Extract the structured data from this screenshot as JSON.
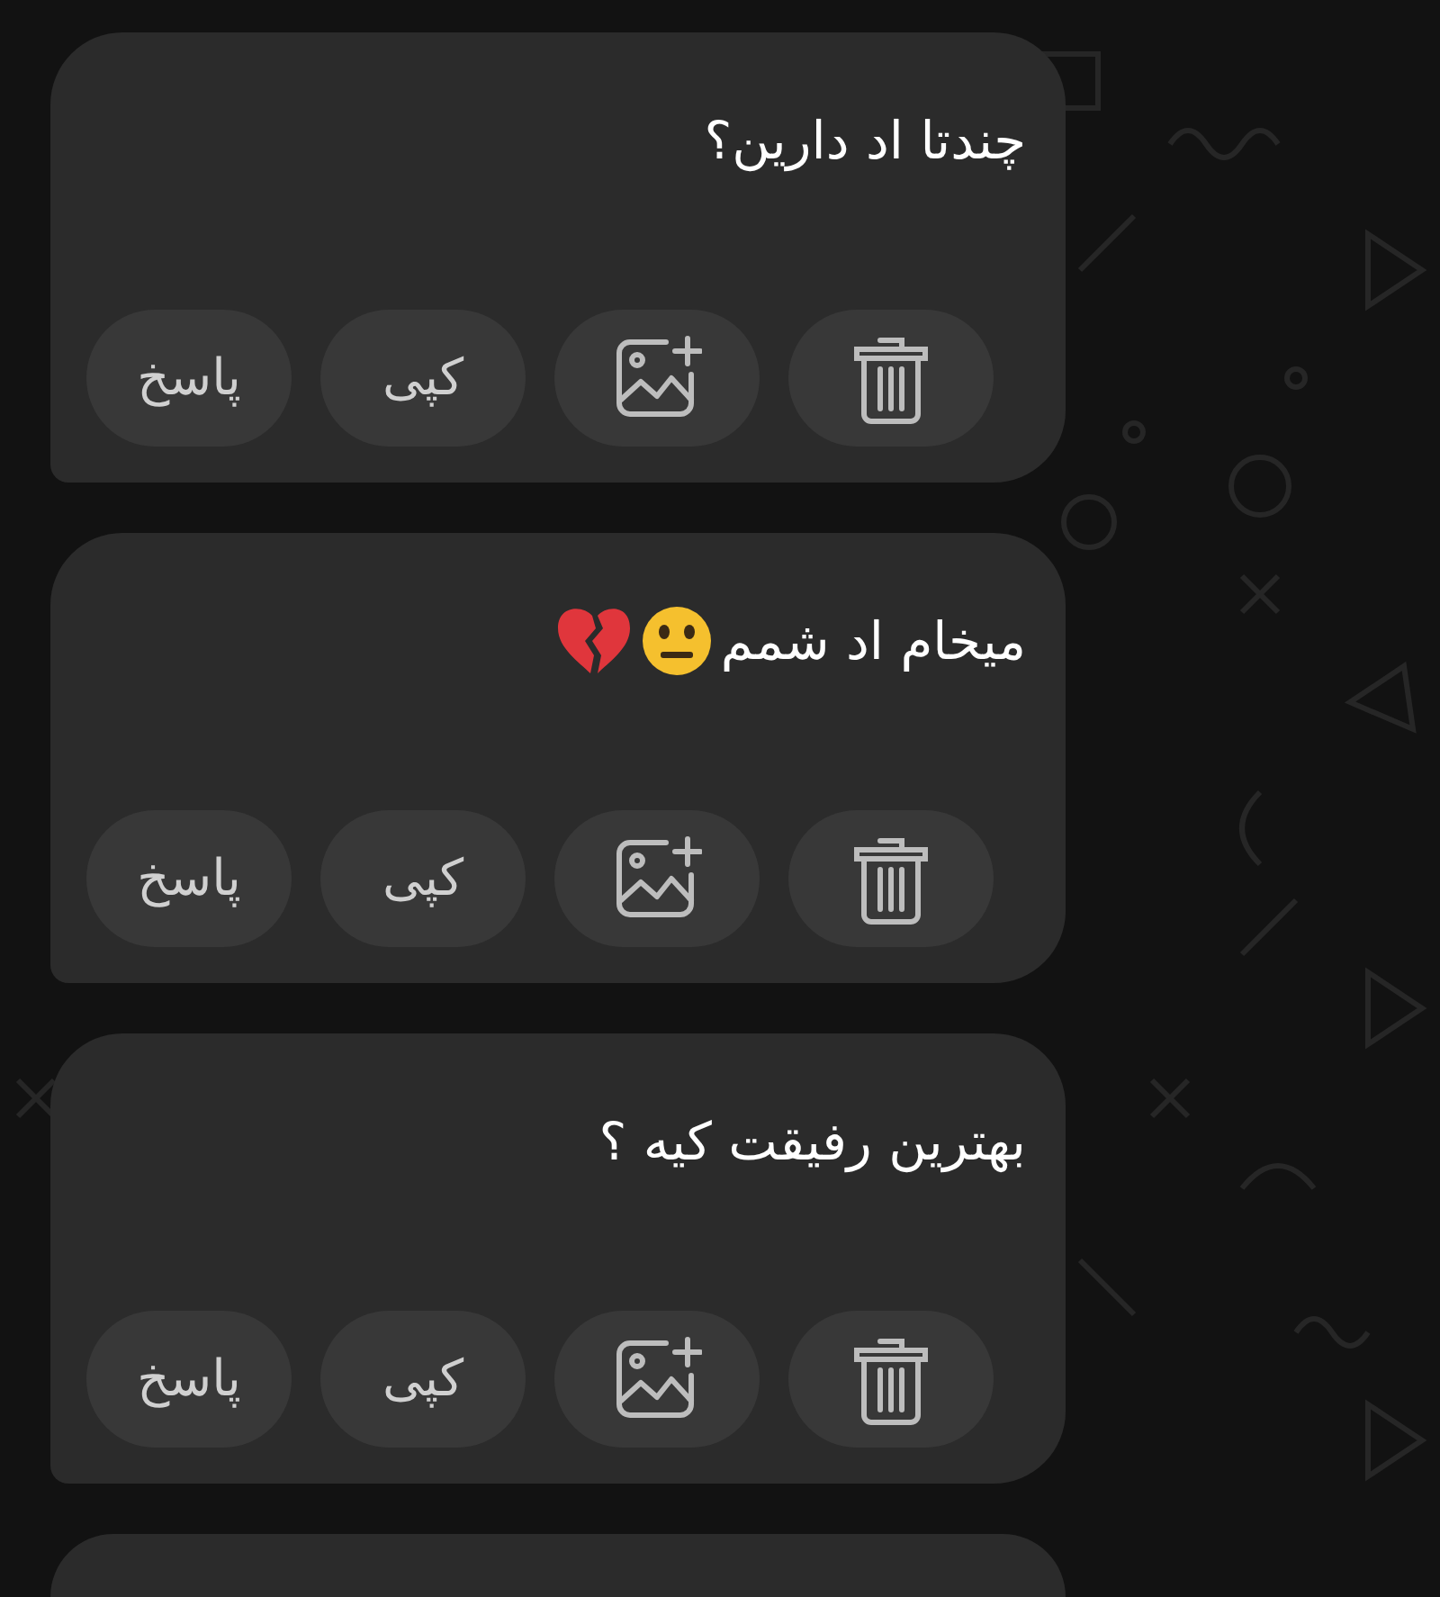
{
  "messages": [
    {
      "text": "چندتا اد دارین؟",
      "actions": [
        {
          "kind": "delete"
        },
        {
          "kind": "image"
        },
        {
          "kind": "copy",
          "label": "کپی"
        },
        {
          "kind": "reply",
          "label": "پاسخ"
        }
      ]
    },
    {
      "text": "میخام اد شمم",
      "emojis": [
        {
          "kind": "neutral-face"
        },
        {
          "kind": "broken-heart"
        }
      ],
      "actions": [
        {
          "kind": "delete"
        },
        {
          "kind": "image"
        },
        {
          "kind": "copy",
          "label": "کپی"
        },
        {
          "kind": "reply",
          "label": "پاسخ"
        }
      ]
    },
    {
      "text": "بهترین رفیقت کیه ؟",
      "actions": [
        {
          "kind": "delete"
        },
        {
          "kind": "image"
        },
        {
          "kind": "copy",
          "label": "کپی"
        },
        {
          "kind": "reply",
          "label": "پاسخ"
        }
      ]
    },
    {
      "kind": "cut-off"
    }
  ]
}
